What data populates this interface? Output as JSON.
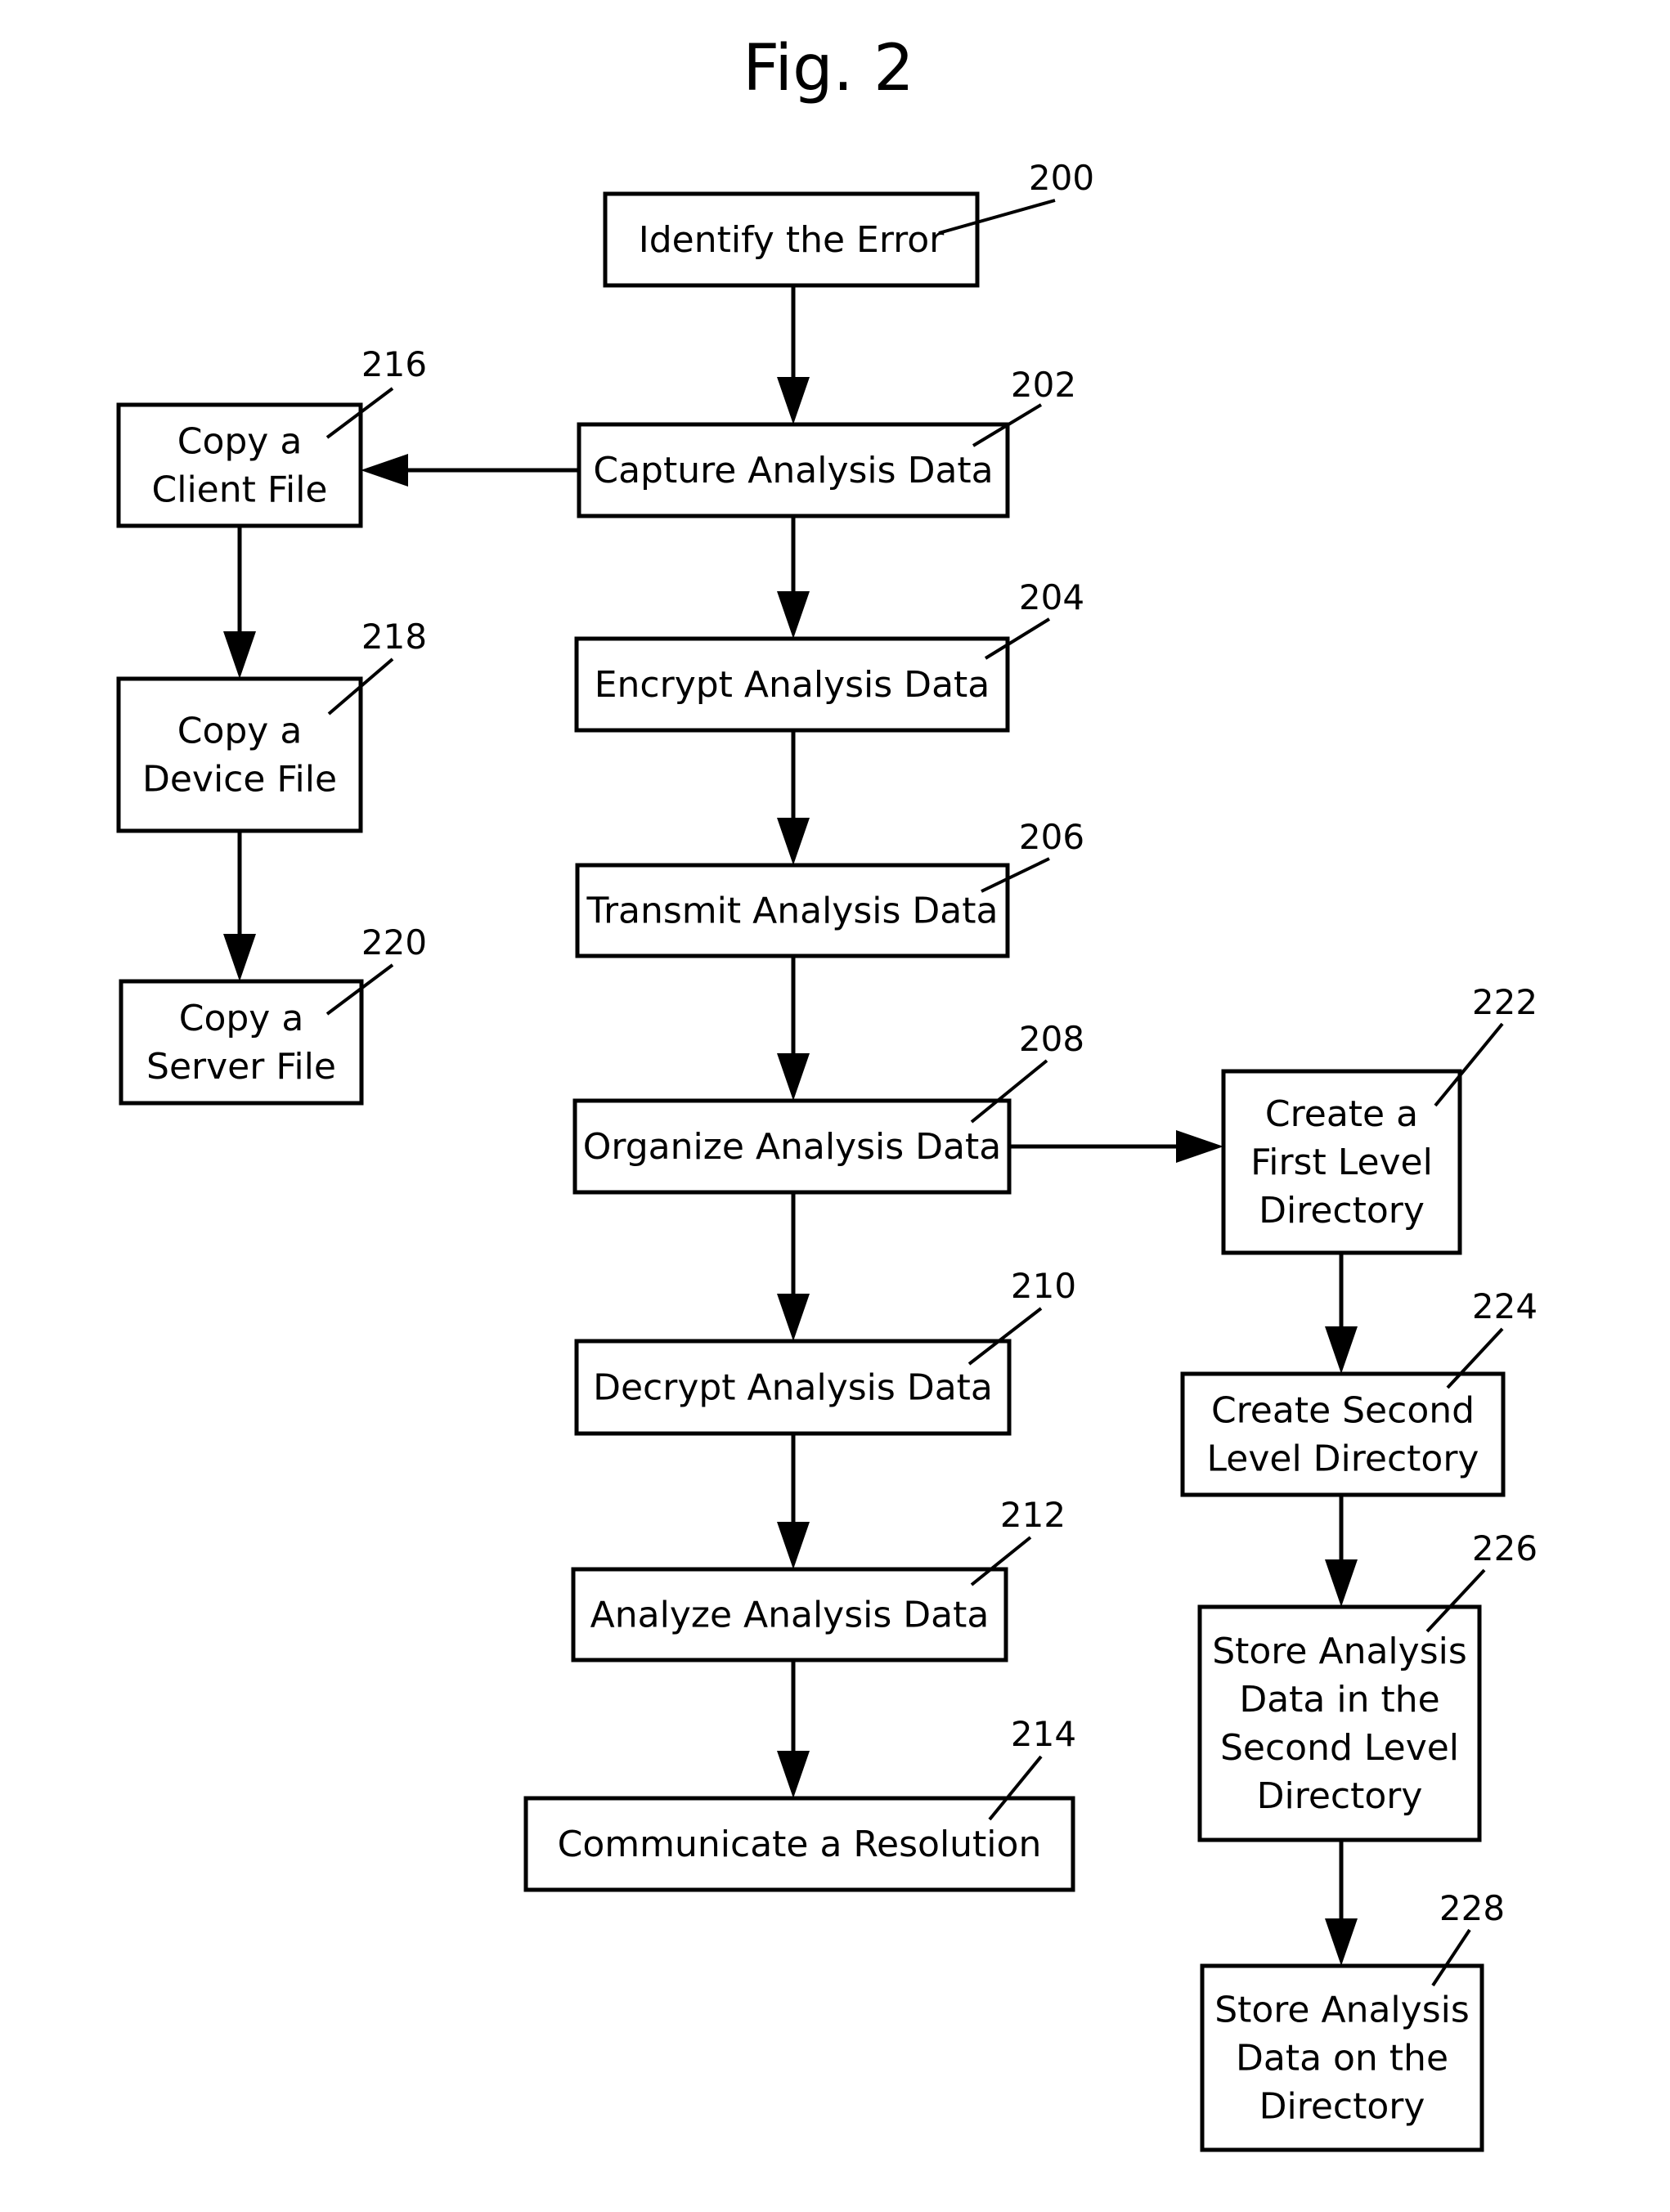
{
  "figure": {
    "title": "Fig. 2"
  },
  "nodes": {
    "n200": {
      "ref": "200",
      "lines": [
        "Identify the Error"
      ]
    },
    "n202": {
      "ref": "202",
      "lines": [
        "Capture Analysis Data"
      ]
    },
    "n204": {
      "ref": "204",
      "lines": [
        "Encrypt Analysis Data"
      ]
    },
    "n206": {
      "ref": "206",
      "lines": [
        "Transmit Analysis Data"
      ]
    },
    "n208": {
      "ref": "208",
      "lines": [
        "Organize Analysis Data"
      ]
    },
    "n210": {
      "ref": "210",
      "lines": [
        "Decrypt Analysis Data"
      ]
    },
    "n212": {
      "ref": "212",
      "lines": [
        "Analyze Analysis Data"
      ]
    },
    "n214": {
      "ref": "214",
      "lines": [
        "Communicate a Resolution"
      ]
    },
    "n216": {
      "ref": "216",
      "lines": [
        "Copy a",
        "Client File"
      ]
    },
    "n218": {
      "ref": "218",
      "lines": [
        "Copy a",
        "Device File"
      ]
    },
    "n220": {
      "ref": "220",
      "lines": [
        "Copy a",
        "Server File"
      ]
    },
    "n222": {
      "ref": "222",
      "lines": [
        "Create a",
        "First Level",
        "Directory"
      ]
    },
    "n224": {
      "ref": "224",
      "lines": [
        "Create Second",
        "Level Directory"
      ]
    },
    "n226": {
      "ref": "226",
      "lines": [
        "Store Analysis",
        "Data in the",
        "Second Level",
        "Directory"
      ]
    },
    "n228": {
      "ref": "228",
      "lines": [
        "Store Analysis",
        "Data on the",
        "Directory"
      ]
    }
  },
  "edges": [
    {
      "from": "200",
      "to": "202"
    },
    {
      "from": "202",
      "to": "204"
    },
    {
      "from": "202",
      "to": "216"
    },
    {
      "from": "204",
      "to": "206"
    },
    {
      "from": "206",
      "to": "208"
    },
    {
      "from": "208",
      "to": "210"
    },
    {
      "from": "208",
      "to": "222"
    },
    {
      "from": "210",
      "to": "212"
    },
    {
      "from": "212",
      "to": "214"
    },
    {
      "from": "216",
      "to": "218"
    },
    {
      "from": "218",
      "to": "220"
    },
    {
      "from": "222",
      "to": "224"
    },
    {
      "from": "224",
      "to": "226"
    },
    {
      "from": "226",
      "to": "228"
    }
  ]
}
